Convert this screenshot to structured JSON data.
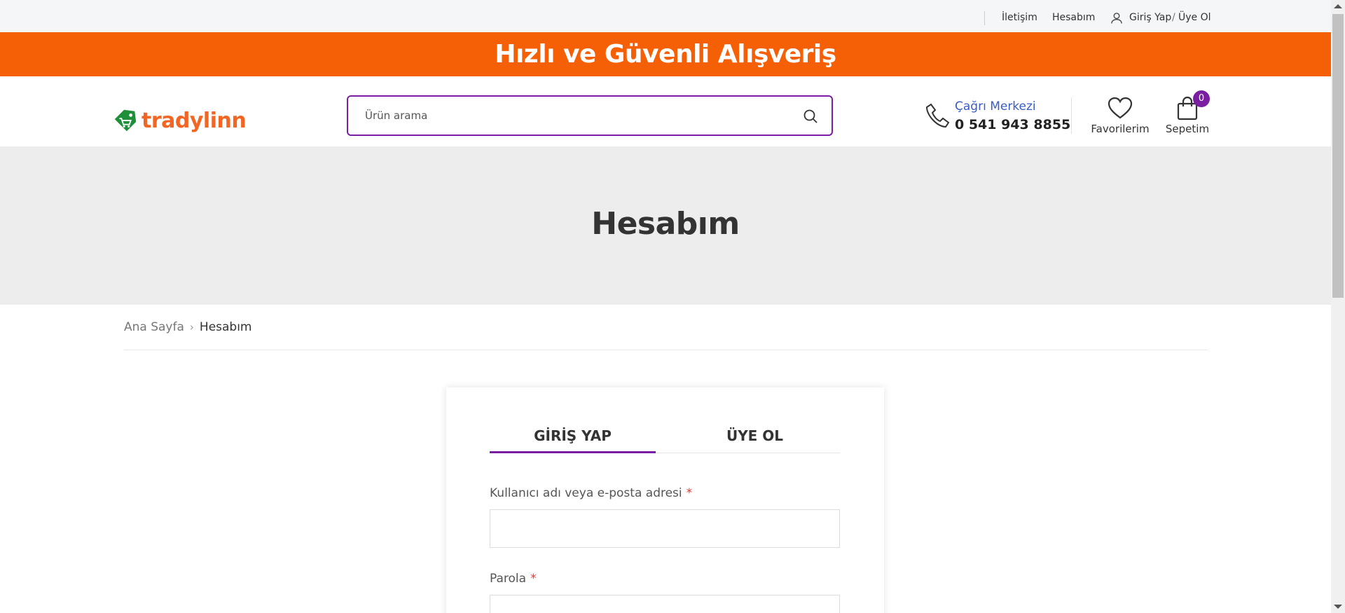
{
  "topbar": {
    "contact_label": "İletişim",
    "account_label": "Hesabım",
    "login_label": "Giriş Yap",
    "separator": "/",
    "register_label": "Üye Ol"
  },
  "banner": {
    "text": "Hızlı ve Güvenli Alışveriş",
    "color": "#f55f05"
  },
  "header": {
    "logo_text": "tradylinn",
    "search": {
      "placeholder": "Ürün arama",
      "value": ""
    },
    "call_center": {
      "title": "Çağrı Merkezi",
      "phone": "0 541 943 8855"
    },
    "favorites_label": "Favorilerim",
    "cart_label": "Sepetim",
    "cart_count": "0",
    "accent_color": "#7b1fa2"
  },
  "hero": {
    "title": "Hesabım"
  },
  "breadcrumb": {
    "home": "Ana Sayfa",
    "separator": "›",
    "current": "Hesabım"
  },
  "auth": {
    "tabs": [
      {
        "label": "GİRİŞ YAP",
        "active": true
      },
      {
        "label": "ÜYE OL",
        "active": false
      }
    ],
    "username_label": "Kullanıcı adı veya e-posta adresi",
    "password_label": "Parola",
    "required_mark": "*",
    "username_value": "",
    "password_value": ""
  }
}
